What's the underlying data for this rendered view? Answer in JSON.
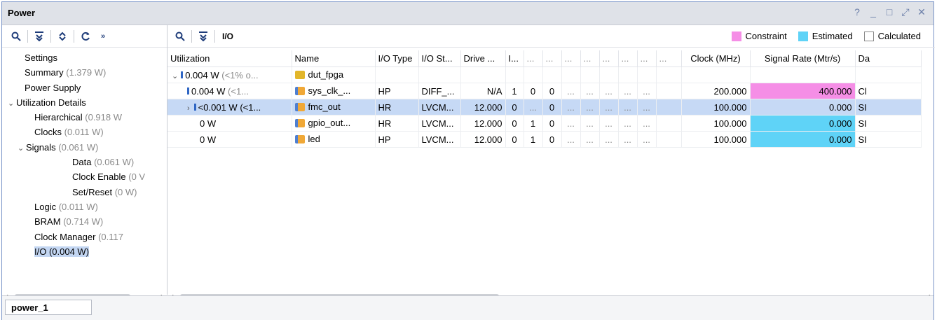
{
  "window": {
    "title": "Power",
    "controls": [
      "?",
      "_",
      "□",
      "⤢",
      "✕"
    ]
  },
  "left_toolbar": {
    "more": "»"
  },
  "tree": [
    {
      "label": "Settings",
      "value": ""
    },
    {
      "label": "Summary",
      "value": "(1.379 W)"
    },
    {
      "label": "Power Supply",
      "value": ""
    },
    {
      "label": "Utilization Details",
      "value": ""
    },
    {
      "label": "Hierarchical",
      "value": "(0.918 W"
    },
    {
      "label": "Clocks",
      "value": "(0.011 W)"
    },
    {
      "label": "Signals",
      "value": "(0.061 W)"
    },
    {
      "label": "Data",
      "value": "(0.061 W)"
    },
    {
      "label": "Clock Enable",
      "value": "(0 V"
    },
    {
      "label": "Set/Reset",
      "value": "(0 W)"
    },
    {
      "label": "Logic",
      "value": "(0.011 W)"
    },
    {
      "label": "BRAM",
      "value": "(0.714 W)"
    },
    {
      "label": "Clock Manager",
      "value": "(0.117"
    },
    {
      "label": "I/O (0.004 W)",
      "value": ""
    }
  ],
  "right_toolbar": {
    "label": "I/O"
  },
  "legend": {
    "constraint": "Constraint",
    "estimated": "Estimated",
    "calculated": "Calculated",
    "constraint_color": "#f58ee6",
    "estimated_color": "#5fd3f7"
  },
  "table": {
    "headers": [
      "Utilization",
      "Name",
      "I/O Type",
      "I/O St...",
      "Drive ...",
      "I...",
      "...",
      "...",
      "...",
      "...",
      "...",
      "...",
      "...",
      "...",
      "Clock (MHz)",
      "Signal Rate (Mtr/s)",
      "Da"
    ],
    "rows": [
      {
        "util": "0.004 W",
        "util_extra": "(<1% o...",
        "name": "dut_fpga",
        "io_type": "",
        "io_std": "",
        "drive": "",
        "c1": "",
        "c2": "",
        "c3": "",
        "d": [
          "",
          "",
          "",
          "",
          "",
          "",
          "",
          ""
        ],
        "clock": "",
        "rate": "",
        "da": ""
      },
      {
        "util": "0.004 W",
        "util_extra": "(<1...",
        "name": "sys_clk_...",
        "io_type": "HP",
        "io_std": "DIFF_...",
        "drive": "N/A",
        "c1": "1",
        "c2": "0",
        "c3": "0",
        "d": [
          "...",
          "...",
          "...",
          "...",
          "..."
        ],
        "clock": "200.000",
        "rate": "400.000",
        "da": "Cl"
      },
      {
        "util": "<0.001 W",
        "util_extra": "(<1...",
        "name": "fmc_out",
        "io_type": "HR",
        "io_std": "LVCM...",
        "drive": "12.000",
        "c1": "0",
        "c2": "...",
        "c3": "0",
        "d": [
          "...",
          "...",
          "...",
          "...",
          "..."
        ],
        "clock": "100.000",
        "rate": "0.000",
        "da": "SI"
      },
      {
        "util": "0 W",
        "util_extra": "",
        "name": "gpio_out...",
        "io_type": "HR",
        "io_std": "LVCM...",
        "drive": "12.000",
        "c1": "0",
        "c2": "1",
        "c3": "0",
        "d": [
          "...",
          "...",
          "...",
          "...",
          "..."
        ],
        "clock": "100.000",
        "rate": "0.000",
        "da": "SI"
      },
      {
        "util": "0 W",
        "util_extra": "",
        "name": "led",
        "io_type": "HP",
        "io_std": "LVCM...",
        "drive": "12.000",
        "c1": "0",
        "c2": "1",
        "c3": "0",
        "d": [
          "...",
          "...",
          "...",
          "...",
          "..."
        ],
        "clock": "100.000",
        "rate": "0.000",
        "da": "SI"
      }
    ]
  },
  "bottom_tab": "power_1"
}
